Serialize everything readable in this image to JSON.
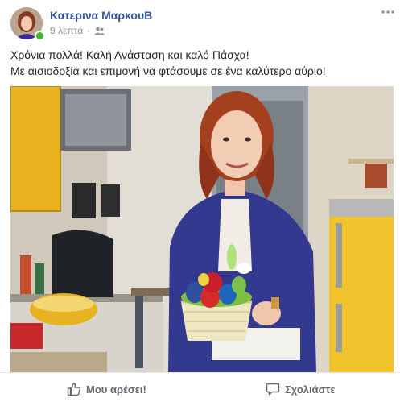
{
  "post": {
    "author_name": "Κατερινα ΜαρκουΒ",
    "timestamp": "9 λεπτά",
    "separator": "·",
    "audience_icon": "friends-icon",
    "more_icon": "more-options-icon",
    "text_lines": [
      "Χρόνια πολλά! Καλή Ανάσταση και καλό Πάσχα!",
      "Με αισιοδοξία και επιμονή να φτάσουμε σε ένα καλύτερο αύριο!"
    ]
  },
  "actions": {
    "like_label": "Μου αρέσει!",
    "comment_label": "Σχολιάστε"
  },
  "colors": {
    "author_link": "#365899",
    "meta_gray": "#90949c",
    "online_green": "#42b72a",
    "action_gray": "#606770"
  }
}
